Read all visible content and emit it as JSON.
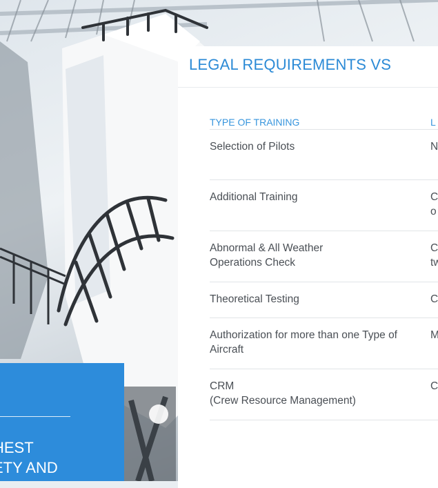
{
  "hero": {
    "image_alt": "flight-simulator-photo"
  },
  "panel": {
    "title": "LEGAL REQUIREMENTS VS",
    "columns": [
      "TYPE OF TRAINING",
      "L"
    ],
    "rows": [
      {
        "type": "Selection of Pilots",
        "value": "N"
      },
      {
        "type": "Additional Training",
        "value": "C\no"
      },
      {
        "type": "Abnormal & All Weather Operations Check",
        "value": "C\ntw"
      },
      {
        "type": "Theoretical Testing",
        "value": "C"
      },
      {
        "type": "Authorization for more than one Type of Aircraft",
        "value": "M"
      },
      {
        "type": "CRM\n(Crew Resource Management)",
        "value": "C"
      }
    ]
  },
  "blue_card": {
    "text": "HEST\nETY AND"
  },
  "colors": {
    "accent": "#2b8ad6",
    "card": "#2d8cdb",
    "text": "#4a4f55"
  }
}
